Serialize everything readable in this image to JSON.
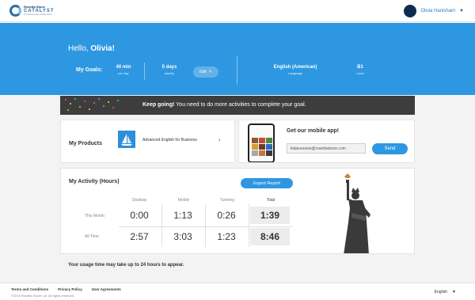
{
  "header": {
    "logo_line1": "Rosetta Stone",
    "logo_line2": "CATALYST",
    "logo_line3": "For Enterprise & Education",
    "user_name": "Olivia Hanisham"
  },
  "hero": {
    "greeting_prefix": "Hello, ",
    "greeting_name": "Olivia!",
    "goals_label": "My Goals:",
    "goal_time_value": "40 min",
    "goal_time_sub": "per day",
    "goal_days_value": "5 days",
    "goal_days_sub": "weekly",
    "edit_label": "Edit",
    "language_value": "English (American)",
    "language_sub": "Language",
    "level_value": "B1",
    "level_sub": "Level"
  },
  "banner": {
    "bold": "Keep going!",
    "text": " You need to do more activities to complete your goal."
  },
  "products": {
    "title": "My Products",
    "item_name": "Advanced English for Business"
  },
  "mobile": {
    "title": "Get our mobile app!",
    "email_value": "klejeunesse@rosettastone.com",
    "send_label": "Send"
  },
  "activity": {
    "title": "My Activity (Hours)",
    "export_label": "Export Report",
    "columns": [
      "Desktop",
      "Mobile",
      "Tutoring",
      "Total"
    ],
    "rows": [
      {
        "label": "This Month",
        "values": [
          "0:00",
          "1:13",
          "0:26",
          "1:39"
        ]
      },
      {
        "label": "All Time",
        "values": [
          "2:57",
          "3:03",
          "1:23",
          "8:46"
        ]
      }
    ]
  },
  "note": "Your usage time may take up to 24 hours to appear.",
  "footer": {
    "links": [
      "Terms and Conditions",
      "Privacy Policy",
      "User Agreements"
    ],
    "copyright": "©2018 Rosetta Stone Ltd. All rights reserved.",
    "language": "English"
  },
  "colors": {
    "accent": "#2e97e1",
    "banner_bg": "#3d3d3d",
    "product_thumb": "#2e8fd9"
  },
  "icons": [
    "logo-mark-icon",
    "avatar-icon",
    "caret-down-icon",
    "pencil-icon",
    "chevron-right-icon",
    "statue-of-liberty-image"
  ]
}
